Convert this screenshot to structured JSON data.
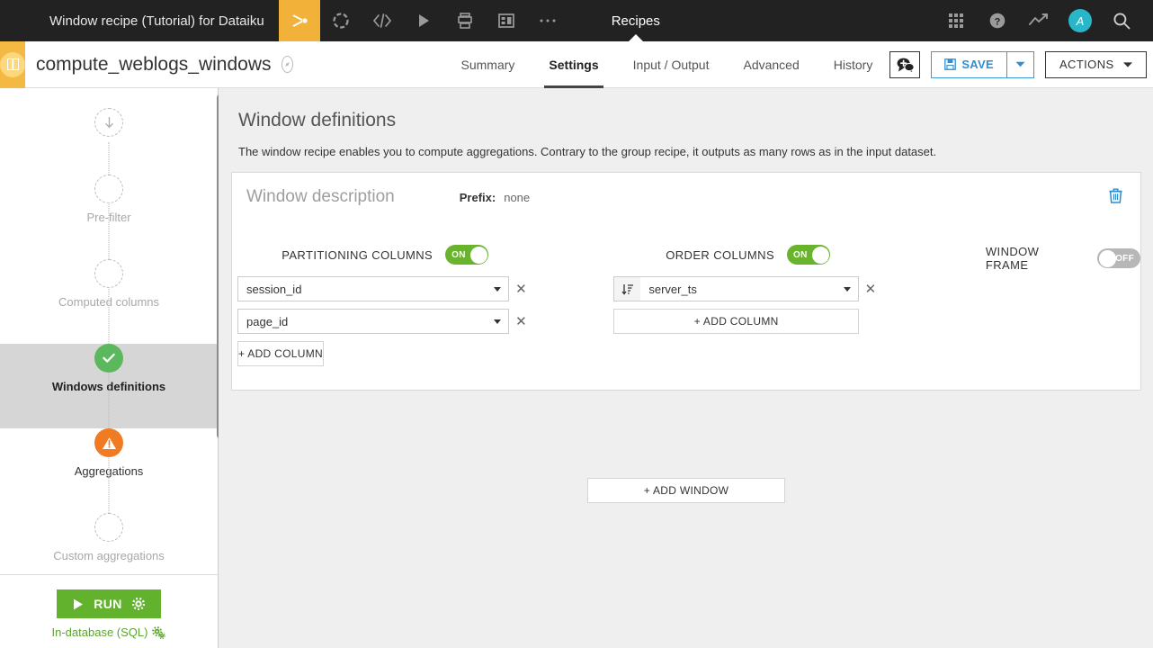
{
  "topbar": {
    "title": "Window recipe (Tutorial) for Dataiku",
    "nav_label": "Recipes",
    "avatar_letter": "A",
    "icons": [
      {
        "name": "recipe-flow-icon",
        "active": true
      },
      {
        "name": "wheel-icon",
        "active": false
      },
      {
        "name": "code-icon",
        "active": false
      },
      {
        "name": "play-icon",
        "active": false
      },
      {
        "name": "jobs-icon",
        "active": false
      },
      {
        "name": "dashboard-icon",
        "active": false
      },
      {
        "name": "more-icon",
        "active": false
      }
    ],
    "right_icons": [
      "apps-grid-icon",
      "help-icon",
      "trend-icon",
      "avatar",
      "search-icon"
    ]
  },
  "subbar": {
    "recipe_name": "compute_weblogs_windows",
    "tabs": [
      {
        "label": "Summary",
        "selected": false
      },
      {
        "label": "Settings",
        "selected": true
      },
      {
        "label": "Input / Output",
        "selected": false
      },
      {
        "label": "Advanced",
        "selected": false
      },
      {
        "label": "History",
        "selected": false
      }
    ],
    "save_label": "SAVE",
    "actions_label": "ACTIONS"
  },
  "sidebar": {
    "steps": [
      {
        "label": "",
        "state": "input",
        "glyph": "↓"
      },
      {
        "label": "Pre-filter",
        "state": "empty",
        "glyph": ""
      },
      {
        "label": "Computed columns",
        "state": "empty",
        "glyph": ""
      },
      {
        "label": "Windows definitions",
        "state": "done",
        "glyph": "✔",
        "active": true
      },
      {
        "label": "Aggregations",
        "state": "warning",
        "glyph": "!"
      },
      {
        "label": "Custom aggregations",
        "state": "empty",
        "glyph": ""
      }
    ],
    "run_label": "RUN",
    "engine_label": "In-database (SQL)"
  },
  "main": {
    "title": "Window definitions",
    "description": "The window recipe enables you to compute aggregations. Contrary to the group recipe, it outputs as many rows as in the input dataset.",
    "add_window_label": "+ ADD WINDOW",
    "window": {
      "description_placeholder": "Window description",
      "prefix_label": "Prefix:",
      "prefix_value": "none",
      "partitioning": {
        "title": "PARTITIONING COLUMNS",
        "toggle": "ON",
        "toggle_on": true,
        "columns": [
          "session_id",
          "page_id"
        ],
        "add_label": "+ ADD COLUMN"
      },
      "order": {
        "title": "ORDER COLUMNS",
        "toggle": "ON",
        "toggle_on": true,
        "columns": [
          "server_ts"
        ],
        "add_label": "+ ADD COLUMN"
      },
      "frame": {
        "title": "WINDOW FRAME",
        "toggle": "OFF",
        "toggle_on": false
      }
    }
  },
  "colors": {
    "topbar_bg": "#222222",
    "accent_orange": "#f4b942",
    "toggle_on": "#69b32d",
    "toggle_off": "#b7b7b7",
    "run_green": "#63b22e",
    "save_blue": "#2d8fd4",
    "done_green": "#5cb85c",
    "warning_orange": "#f07b22"
  }
}
